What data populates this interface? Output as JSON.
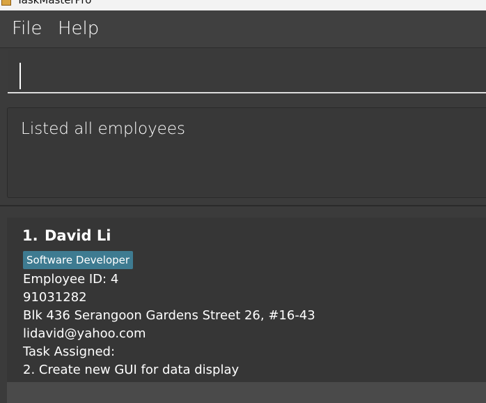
{
  "window": {
    "title": "TaskMasterPro"
  },
  "menu": {
    "file": "File",
    "help": "Help"
  },
  "command": {
    "value": ""
  },
  "result": {
    "message": "Listed all employees"
  },
  "employees": [
    {
      "index": "1.",
      "name": "David Li",
      "tag": "Software Developer",
      "employee_id": "Employee ID: 4",
      "phone": "91031282",
      "address": "Blk 436 Serangoon Gardens Street 26, #16-43",
      "email": "lidavid@yahoo.com",
      "tasks_label": "Task Assigned:",
      "task": "2. Create new GUI for data display"
    }
  ],
  "colors": {
    "background": "#3b3b3b",
    "menubar": "#404040",
    "tag": "#3e7b91",
    "text": "#ffffff"
  },
  "icons": {
    "app": "app-icon"
  }
}
